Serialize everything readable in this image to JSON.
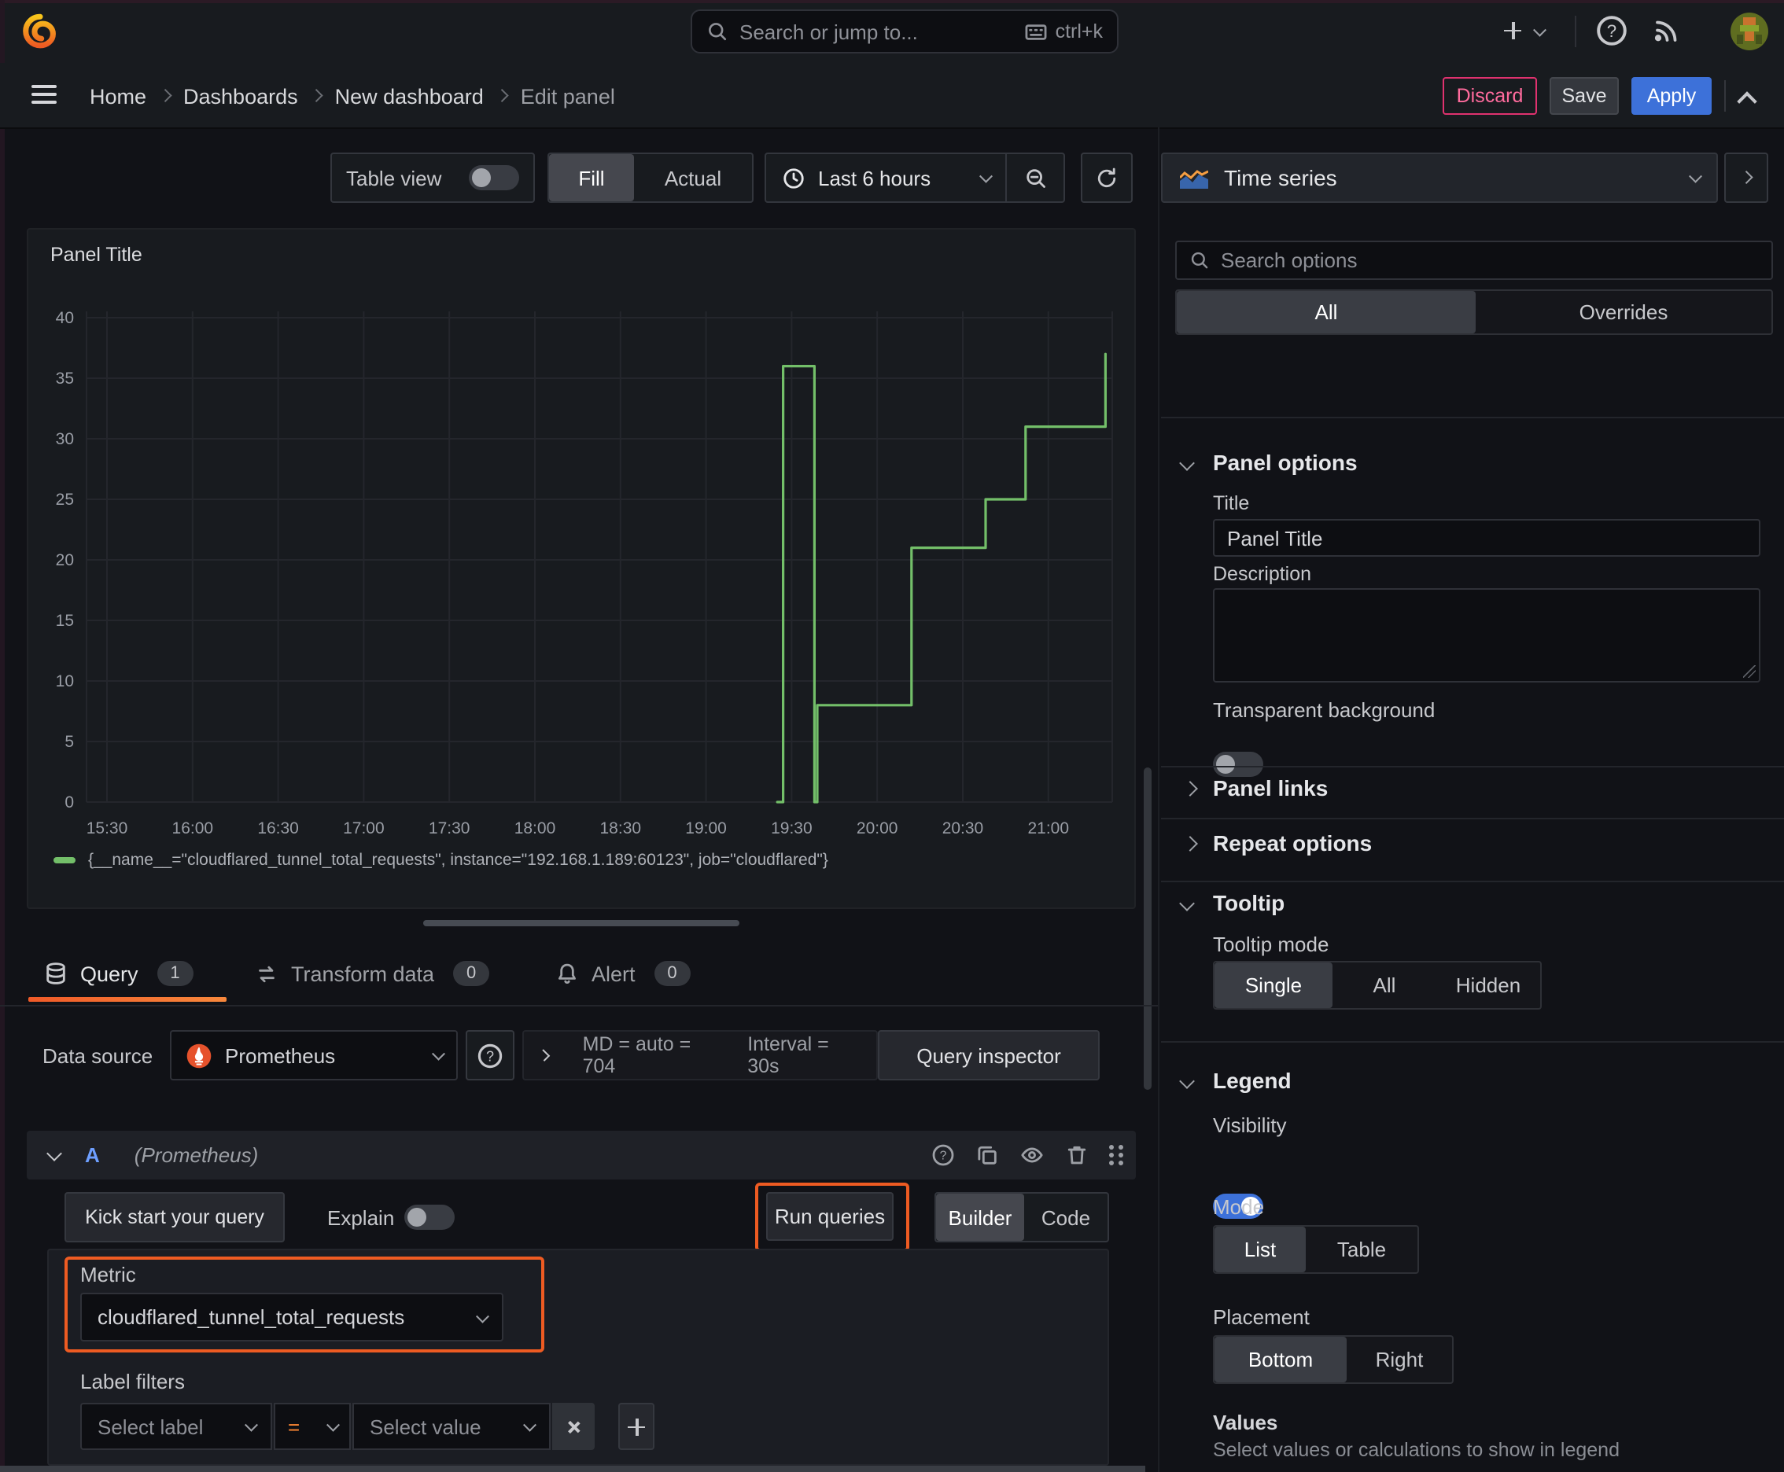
{
  "topbar": {
    "search_placeholder": "Search or jump to...",
    "shortcut": "ctrl+k"
  },
  "breadcrumb": {
    "items": [
      "Home",
      "Dashboards",
      "New dashboard"
    ],
    "current": "Edit panel"
  },
  "actions": {
    "discard": "Discard",
    "save": "Save",
    "apply": "Apply"
  },
  "toolbar": {
    "table_view": "Table view",
    "fill": "Fill",
    "actual": "Actual",
    "time_range": "Last 6 hours"
  },
  "viz_picker": {
    "value": "Time series"
  },
  "panel": {
    "title": "Panel Title"
  },
  "chart_data": {
    "type": "line",
    "line_style": "stepped",
    "color": "#73bf69",
    "title": "Panel Title",
    "xlabel": "",
    "ylabel": "",
    "grid": true,
    "legend_position": "bottom",
    "x_ticks": [
      "15:30",
      "16:00",
      "16:30",
      "17:00",
      "17:30",
      "18:00",
      "18:30",
      "19:00",
      "19:30",
      "20:00",
      "20:30",
      "21:00"
    ],
    "x_tick_minutes": [
      0,
      30,
      60,
      90,
      120,
      150,
      180,
      210,
      240,
      270,
      300,
      330
    ],
    "x_unit": "minutes after 15:30",
    "x_range_minutes": [
      -7,
      352
    ],
    "y_ticks": [
      0,
      5,
      10,
      15,
      20,
      25,
      30,
      35,
      40
    ],
    "ylim": [
      0,
      40.5
    ],
    "series": [
      {
        "name": "{__name__=\"cloudflared_tunnel_total_requests\", instance=\"192.168.1.189:60123\", job=\"cloudflared\"}",
        "points": [
          [
            235,
            0
          ],
          [
            237,
            0
          ],
          [
            237,
            36
          ],
          [
            248,
            36
          ],
          [
            248,
            0
          ],
          [
            249,
            0
          ],
          [
            249,
            8
          ],
          [
            282,
            8
          ],
          [
            282,
            21
          ],
          [
            308,
            21
          ],
          [
            308,
            25
          ],
          [
            322,
            25
          ],
          [
            322,
            31
          ],
          [
            350,
            31
          ],
          [
            350,
            37
          ]
        ]
      }
    ]
  },
  "tabs": {
    "query": "Query",
    "query_count": "1",
    "transform": "Transform data",
    "transform_count": "0",
    "alert": "Alert",
    "alert_count": "0"
  },
  "datasource": {
    "label": "Data source",
    "name": "Prometheus",
    "stats_md": "MD = auto = 704",
    "stats_interval": "Interval = 30s",
    "inspector": "Query inspector"
  },
  "query": {
    "refid": "A",
    "datasource_hint": "(Prometheus)",
    "kickstart": "Kick start your query",
    "explain": "Explain",
    "run": "Run queries",
    "builder": "Builder",
    "code": "Code"
  },
  "metric_editor": {
    "metric_label": "Metric",
    "metric_value": "cloudflared_tunnel_total_requests",
    "label_filters": "Label filters",
    "select_label": "Select label",
    "operator": "=",
    "select_value": "Select value"
  },
  "options": {
    "search_placeholder": "Search options",
    "tab_all": "All",
    "tab_overrides": "Overrides",
    "panel_options": "Panel options",
    "title_label": "Title",
    "title_value": "Panel Title",
    "description_label": "Description",
    "transparent": "Transparent background",
    "panel_links": "Panel links",
    "repeat_options": "Repeat options",
    "tooltip": "Tooltip",
    "tooltip_mode": "Tooltip mode",
    "mode_single": "Single",
    "mode_all": "All",
    "mode_hidden": "Hidden",
    "legend": "Legend",
    "visibility": "Visibility",
    "mode": "Mode",
    "list": "List",
    "table": "Table",
    "placement": "Placement",
    "bottom": "Bottom",
    "right": "Right",
    "values_label": "Values",
    "values_hint": "Select values or calculations to show in legend"
  },
  "colors": {
    "accent_orange": "#ee5b22",
    "series_green": "#73bf69",
    "primary_blue": "#3d71d9",
    "discard_red": "#e0326f",
    "refid_blue": "#6e9fff",
    "tab_underline_from": "#f05a28",
    "tab_underline_to": "#f8883c"
  }
}
